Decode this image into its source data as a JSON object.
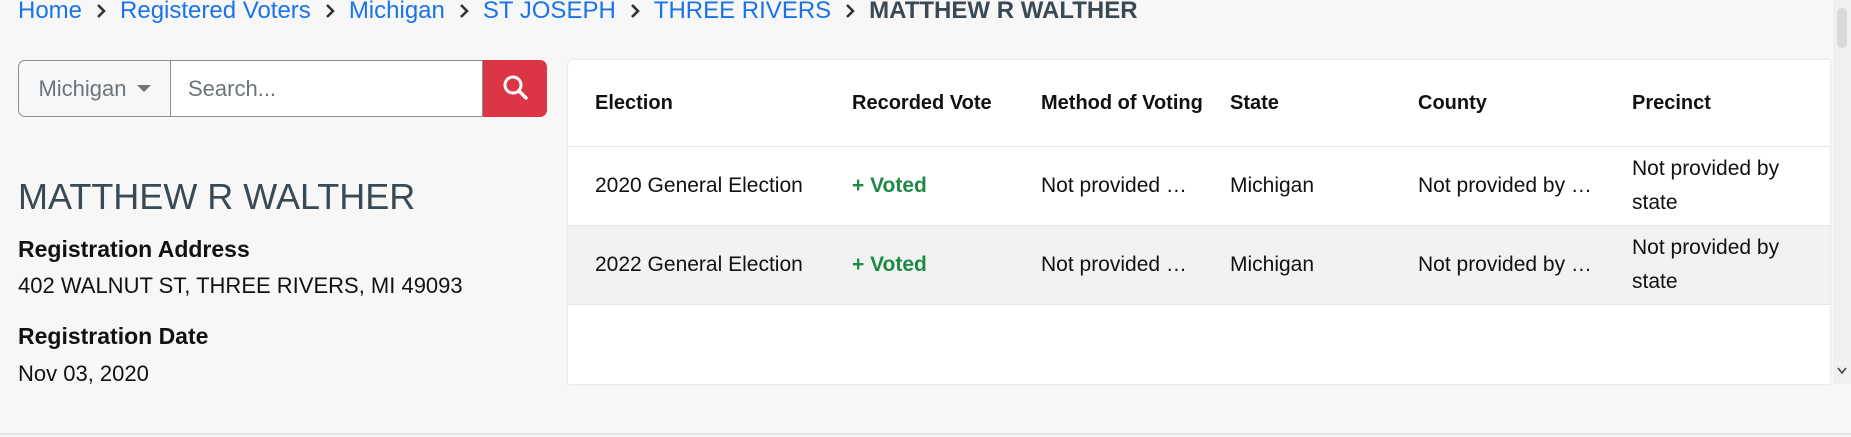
{
  "breadcrumb": [
    {
      "label": "Home"
    },
    {
      "label": "Registered Voters"
    },
    {
      "label": "Michigan"
    },
    {
      "label": "ST JOSEPH"
    },
    {
      "label": "THREE RIVERS"
    }
  ],
  "breadcrumb_current": "MATTHEW R WALTHER",
  "search": {
    "state_selected": "Michigan",
    "placeholder": "Search...",
    "value": ""
  },
  "voter": {
    "name": "MATTHEW R WALTHER",
    "registration_address_label": "Registration Address",
    "registration_address": "402 WALNUT ST, THREE RIVERS, MI 49093",
    "registration_date_label": "Registration Date",
    "registration_date": "Nov 03, 2020"
  },
  "table": {
    "headers": [
      "Election",
      "Recorded Vote",
      "Method of Voting",
      "State",
      "County",
      "Precinct"
    ],
    "rows": [
      {
        "election": "2020 General Election",
        "vote": "+ Voted",
        "method": "Not provided …",
        "state": "Michigan",
        "county": "Not provided by …",
        "precinct": "Not provided by state"
      },
      {
        "election": "2022 General Election",
        "vote": "+ Voted",
        "method": "Not provided …",
        "state": "Michigan",
        "county": "Not provided by …",
        "precinct": "Not provided by state"
      }
    ]
  },
  "colors": {
    "link": "#1a73e8",
    "search_button": "#dc3545",
    "voted": "#1e8a44"
  },
  "icons": {
    "search": "search-icon",
    "breadcrumb_separator": "chevron-right-icon",
    "dropdown": "caret-down-icon"
  }
}
